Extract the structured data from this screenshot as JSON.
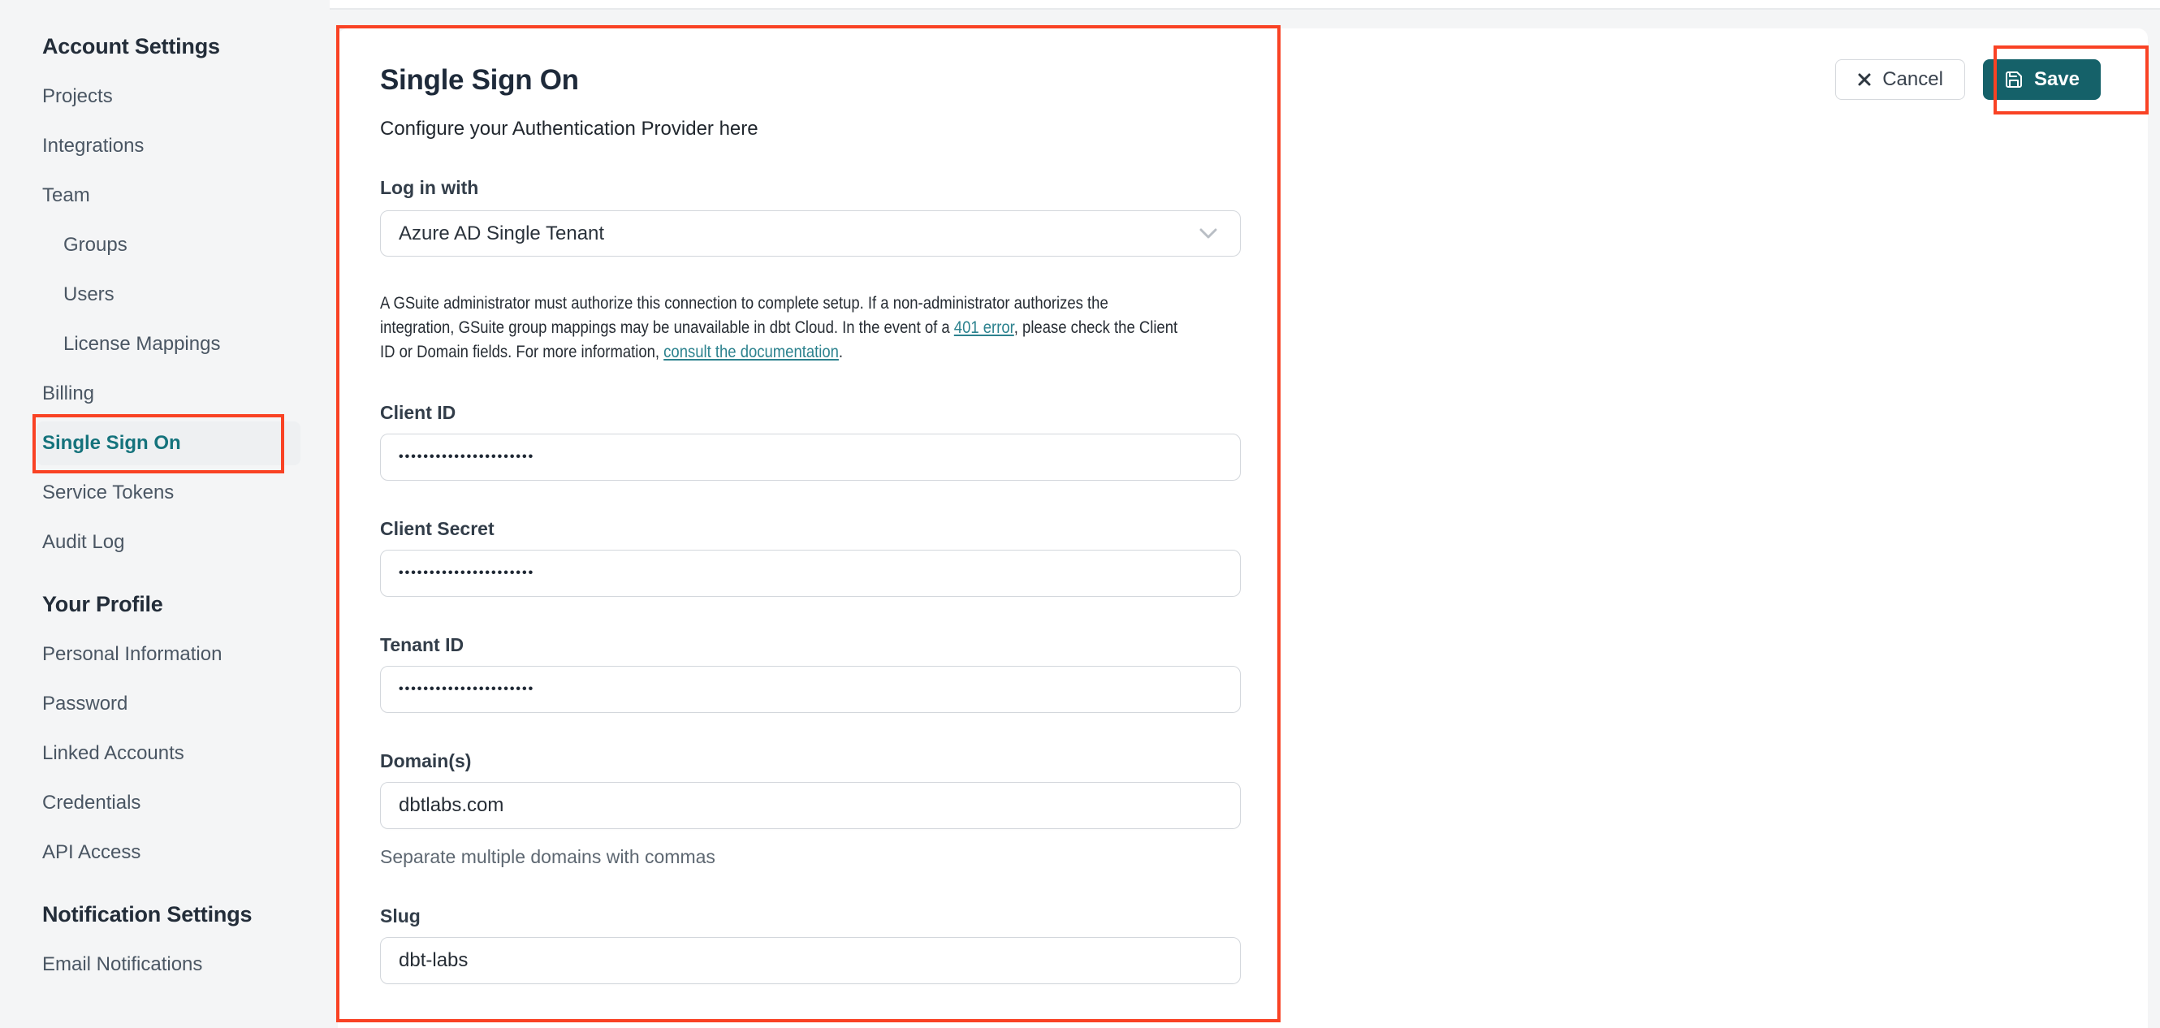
{
  "colors": {
    "accent_teal": "#156169",
    "active_item_teal": "#15737c",
    "link_teal": "#2c828e",
    "annotation_red": "#f94224",
    "page_background": "#f4f5f6"
  },
  "sidebar": {
    "sections": [
      {
        "heading": "Account Settings",
        "items": [
          {
            "label": "Projects"
          },
          {
            "label": "Integrations"
          },
          {
            "label": "Team",
            "expanded": true,
            "icon": "chevron-up-icon"
          },
          {
            "label": "Groups",
            "indent": true
          },
          {
            "label": "Users",
            "indent": true
          },
          {
            "label": "License Mappings",
            "indent": true
          },
          {
            "label": "Billing"
          },
          {
            "label": "Single Sign On",
            "active": true
          },
          {
            "label": "Service Tokens"
          },
          {
            "label": "Audit Log"
          }
        ]
      },
      {
        "heading": "Your Profile",
        "items": [
          {
            "label": "Personal Information"
          },
          {
            "label": "Password"
          },
          {
            "label": "Linked Accounts"
          },
          {
            "label": "Credentials"
          },
          {
            "label": "API Access"
          }
        ]
      },
      {
        "heading": "Notification Settings",
        "items": [
          {
            "label": "Email Notifications"
          }
        ]
      }
    ]
  },
  "header": {
    "title": "Single Sign On",
    "subtitle": "Configure your Authentication Provider here",
    "cancel_label": "Cancel",
    "cancel_icon": "x-icon",
    "save_label": "Save",
    "save_icon": "floppy-disk-icon"
  },
  "form": {
    "login_with": {
      "label": "Log in with",
      "value": "Azure AD Single Tenant",
      "icon": "chevron-down-icon"
    },
    "note": {
      "line1": "A GSuite administrator must authorize this connection to complete setup. If a non-administrator authorizes the",
      "line2_pre": "integration, GSuite group mappings may be unavailable in dbt Cloud. In the event of a ",
      "link1": "401 error",
      "line2_post": ", please check the Client",
      "line3_pre": "ID or Domain fields. For more information, ",
      "link2": "consult the documentation",
      "line3_post": "."
    },
    "client_id": {
      "label": "Client ID",
      "masked_value": "••••••••••••••••••••••"
    },
    "client_secret": {
      "label": "Client Secret",
      "masked_value": "••••••••••••••••••••••"
    },
    "tenant_id": {
      "label": "Tenant ID",
      "masked_value": "••••••••••••••••••••••"
    },
    "domains": {
      "label": "Domain(s)",
      "value": "dbtlabs.com",
      "helper": "Separate multiple domains with commas"
    },
    "slug": {
      "label": "Slug",
      "value": "dbt-labs"
    }
  }
}
